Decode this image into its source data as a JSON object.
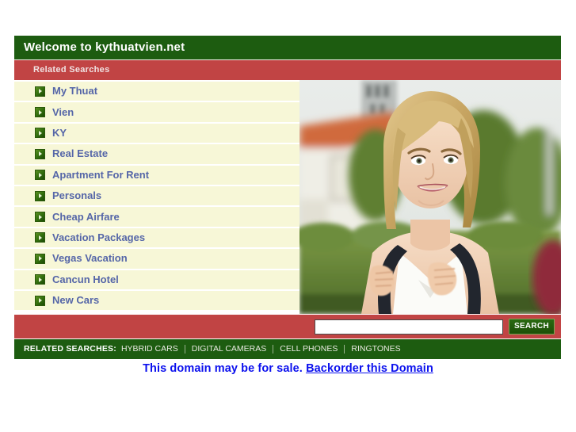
{
  "header": {
    "title": "Welcome to kythuatvien.net",
    "subtitle": "Related Searches",
    "bg_color": "#1d5c10",
    "sub_bg_color": "#c14444"
  },
  "related_searches_list": [
    {
      "label": "My Thuat",
      "icon": "arrow-right-icon"
    },
    {
      "label": "Vien",
      "icon": "arrow-right-icon"
    },
    {
      "label": "KY",
      "icon": "arrow-right-icon"
    },
    {
      "label": "Real Estate",
      "icon": "arrow-right-icon"
    },
    {
      "label": "Apartment For Rent",
      "icon": "arrow-right-icon"
    },
    {
      "label": "Personals",
      "icon": "arrow-right-icon"
    },
    {
      "label": "Cheap Airfare",
      "icon": "arrow-right-icon"
    },
    {
      "label": "Vacation Packages",
      "icon": "arrow-right-icon"
    },
    {
      "label": "Vegas Vacation",
      "icon": "arrow-right-icon"
    },
    {
      "label": "Cancun Hotel",
      "icon": "arrow-right-icon"
    },
    {
      "label": "New Cars",
      "icon": "arrow-right-icon"
    }
  ],
  "photo": {
    "alt": "Smiling blonde young woman wearing a white top and a dark backpack, standing outdoors in front of a tile-roofed building and green hedges"
  },
  "search": {
    "value": "",
    "placeholder": "",
    "button_label": "SEARCH"
  },
  "footer_strip": {
    "label": "RELATED SEARCHES:",
    "items": [
      "HYBRID CARS",
      "DIGITAL CAMERAS",
      "CELL PHONES",
      "RINGTONES"
    ]
  },
  "sale_notice": {
    "text": "This domain may be for sale.",
    "link_label": "Backorder this Domain",
    "color": "#0b10ee"
  },
  "colors": {
    "green": "#1d5c10",
    "red": "#c14444",
    "row_cream": "#f7f7d7",
    "link_blue": "#5566a8"
  }
}
